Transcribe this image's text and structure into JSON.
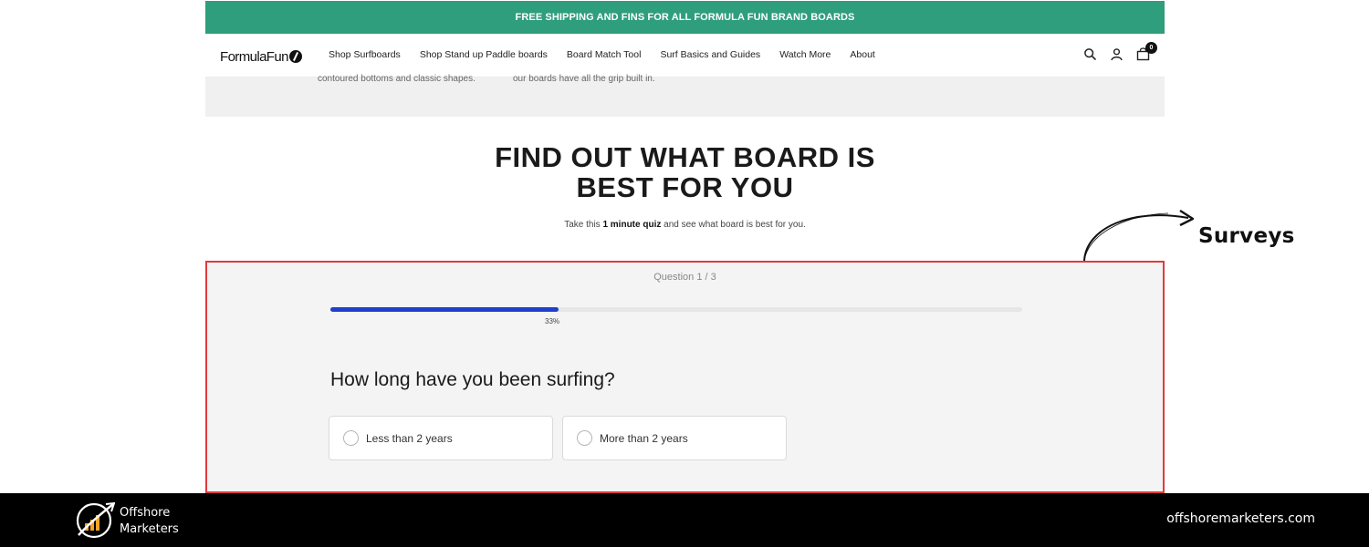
{
  "banner": {
    "text": "FREE SHIPPING AND FINS FOR ALL FORMULA FUN BRAND BOARDS"
  },
  "brand": {
    "logo_text": "FormulaFun"
  },
  "nav": {
    "items": [
      {
        "label": "Shop Surfboards"
      },
      {
        "label": "Shop Stand up Paddle boards"
      },
      {
        "label": "Board Match Tool"
      },
      {
        "label": "Surf Basics and Guides"
      },
      {
        "label": "Watch More"
      },
      {
        "label": "About"
      }
    ],
    "icons": [
      "search-icon",
      "account-icon",
      "cart-icon"
    ],
    "cart_count": "0"
  },
  "band": {
    "left_text": "contoured bottoms and classic shapes.",
    "right_text": "our boards have all the grip built in."
  },
  "hero": {
    "title_line1": "FIND OUT WHAT BOARD IS",
    "title_line2": "BEST FOR YOU",
    "subtitle_pre": "Take this ",
    "subtitle_bold": "1 minute quiz",
    "subtitle_post": " and see what board is best for you."
  },
  "quiz": {
    "counter": "Question 1 / 3",
    "progress": 0.33,
    "progress_label": "33%",
    "question": "How long have you been surfing?",
    "options": [
      {
        "label": "Less than 2 years",
        "selected": false
      },
      {
        "label": "More than 2 years",
        "selected": false
      }
    ]
  },
  "annotation": {
    "label": "Surveys"
  },
  "footer": {
    "brand_line1": "Offshore",
    "brand_line2": "Marketers",
    "url": "offshoremarketers.com"
  },
  "colors": {
    "banner_bg": "#2e9e7c",
    "progress_fill": "#1f3fcc",
    "highlight_border": "#e03b3b",
    "footer_bg": "#000000",
    "logo_accent": "#f5a623"
  }
}
